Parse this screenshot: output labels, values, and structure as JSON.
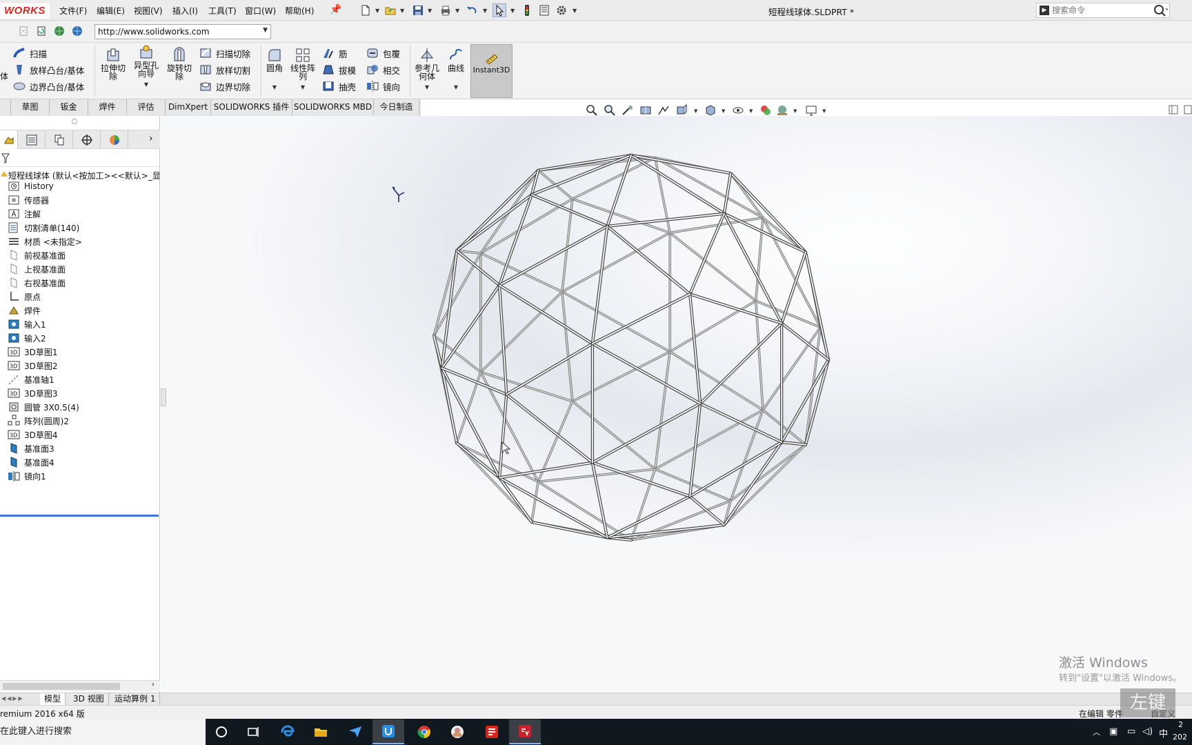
{
  "app": {
    "brand": "WORKS",
    "document_title": "短程线球体.SLDPRT *",
    "menu": [
      "文件(F)",
      "编辑(E)",
      "视图(V)",
      "插入(I)",
      "工具(T)",
      "窗口(W)",
      "帮助(H)"
    ],
    "search_placeholder": "搜索命令"
  },
  "webbar": {
    "url": "http://www.solidworks.com"
  },
  "command_manager": {
    "features_col1": [
      "扫描",
      "放样凸台/基体",
      "边界凸台/基体"
    ],
    "partial_left": "体",
    "big1": "拉伸切\n除",
    "big2": "异型孔\n向导",
    "big3": "旋转切\n除",
    "cut_col": [
      "扫描切除",
      "放样切割",
      "边界切除"
    ],
    "fillet": "圆角",
    "pattern": "线性阵\n列",
    "col_a": [
      "筋",
      "拔模",
      "抽壳"
    ],
    "col_b": [
      "包覆",
      "相交",
      "镜向"
    ],
    "ref_geom": "参考几\n何体",
    "curves": "曲线",
    "instant3d": "Instant3D"
  },
  "tabs": [
    "草图",
    "钣金",
    "焊件",
    "评估",
    "DimXpert",
    "SOLIDWORKS 插件",
    "SOLIDWORKS MBD",
    "今日制造"
  ],
  "feature_tree": {
    "root": "短程线球体 (默认<按加工><<默认>_显",
    "items": [
      {
        "label": "History",
        "icon": "history-icon"
      },
      {
        "label": "传感器",
        "icon": "sensor-icon"
      },
      {
        "label": "注解",
        "icon": "annotation-icon"
      },
      {
        "label": "切割清单(140)",
        "icon": "cut-list-icon"
      },
      {
        "label": "材质 <未指定>",
        "icon": "material-icon"
      },
      {
        "label": "前视基准面",
        "icon": "plane-icon"
      },
      {
        "label": "上视基准面",
        "icon": "plane-icon"
      },
      {
        "label": "右视基准面",
        "icon": "plane-icon"
      },
      {
        "label": "原点",
        "icon": "origin-icon"
      },
      {
        "label": "焊件",
        "icon": "weldment-icon"
      },
      {
        "label": "输入1",
        "icon": "import-icon"
      },
      {
        "label": "输入2",
        "icon": "import-icon"
      },
      {
        "label": "3D草图1",
        "icon": "sketch-3d-icon"
      },
      {
        "label": "3D草图2",
        "icon": "sketch-3d-icon"
      },
      {
        "label": "基准轴1",
        "icon": "axis-icon"
      },
      {
        "label": "3D草图3",
        "icon": "sketch-3d-icon"
      },
      {
        "label": "圆管 3X0.5(4)",
        "icon": "structural-member-icon"
      },
      {
        "label": "阵列(圆周)2",
        "icon": "circular-pattern-icon"
      },
      {
        "label": "3D草图4",
        "icon": "sketch-3d-icon"
      },
      {
        "label": "基准面3",
        "icon": "plane-solid-icon"
      },
      {
        "label": "基准面4",
        "icon": "plane-solid-icon"
      },
      {
        "label": "镜向1",
        "icon": "mirror-icon"
      }
    ]
  },
  "bottom_tabs": [
    "模型",
    "3D 视图",
    "运动算例 1"
  ],
  "status": {
    "left": "remium 2016 x64 版",
    "editing": "在编辑 零件",
    "custom": "自定义"
  },
  "overlay_text": "左键",
  "watermark": {
    "line1": "激活 Windows",
    "line2": "转到\"设置\"以激活 Windows。"
  },
  "taskbar": {
    "search_text": "在此键入进行搜索",
    "ime": "中",
    "clock_partial": "2",
    "date_partial": "202"
  },
  "colors": {
    "accent": "#3b78d8",
    "brand_red": "#e2231a",
    "taskbar": "#101820"
  }
}
